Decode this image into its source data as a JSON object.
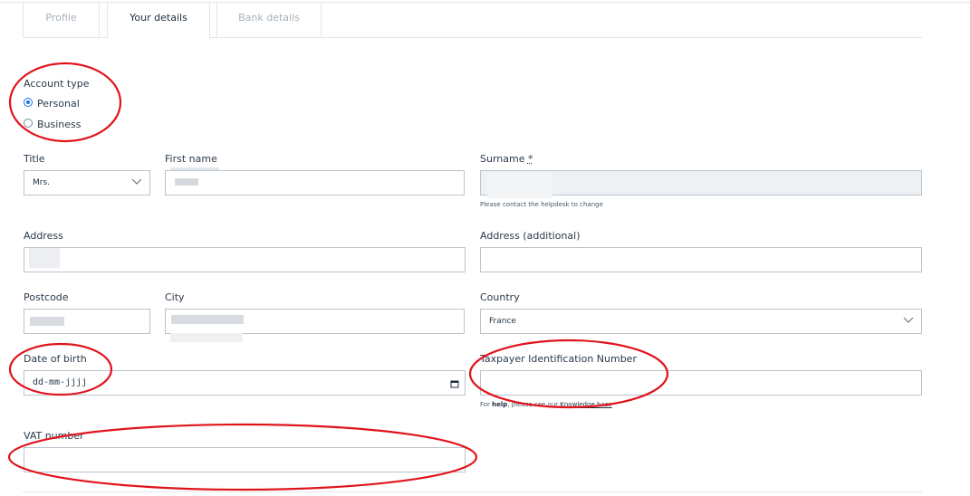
{
  "tabs": [
    {
      "label": "Profile",
      "active": false
    },
    {
      "label": "Your details",
      "active": true
    },
    {
      "label": "Bank details",
      "active": false
    }
  ],
  "account_type": {
    "label": "Account type",
    "options": [
      "Personal",
      "Business"
    ],
    "selected": "Personal"
  },
  "form": {
    "title_label": "Title",
    "title_value": "Mrs.",
    "first_name_label": "First name",
    "surname_label": "Surname",
    "surname_required_mark": "*",
    "surname_hint": "Please contact the helpdesk to change",
    "address_label": "Address",
    "address_additional_label": "Address (additional)",
    "postcode_label": "Postcode",
    "city_label": "City",
    "country_label": "Country",
    "country_value": "France",
    "dob_label": "Date of birth",
    "dob_placeholder": "dd-mm-jjjj",
    "tin_label": "Taxpayer Identification Number",
    "tin_hint_prefix": "For",
    "tin_hint_bold": "help",
    "tin_hint_middle": ", please see our",
    "tin_hint_link": "Knowledge base",
    "vat_label": "VAT number"
  },
  "colors": {
    "annotation": "#e0141c",
    "radio_selected": "#1a73e8",
    "border": "#b9c3cc"
  }
}
